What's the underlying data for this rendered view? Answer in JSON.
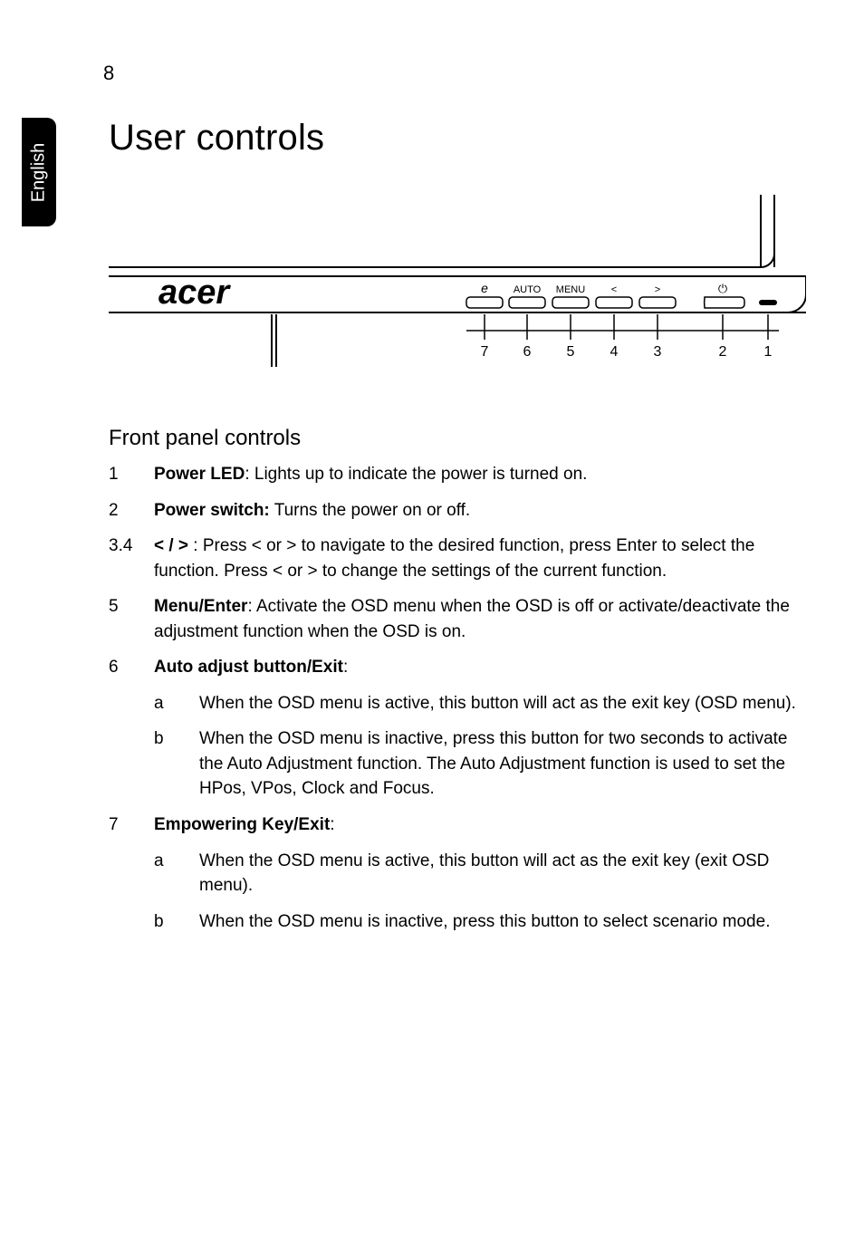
{
  "page_number": "8",
  "side_tab": "English",
  "heading": "User controls",
  "subheading": "Front panel controls",
  "diagram": {
    "brand": "acer",
    "buttons": {
      "empower_icon": "e",
      "auto": "AUTO",
      "menu": "MENU",
      "left": "<",
      "right": ">",
      "power_icon": "⏻"
    },
    "callouts": [
      "7",
      "6",
      "5",
      "4",
      "3",
      "2",
      "1"
    ]
  },
  "items": [
    {
      "n": "1",
      "label": "Power LED",
      "sep": ": ",
      "text": "Lights up to indicate the power is turned on."
    },
    {
      "n": "2",
      "label": "Power switch:",
      "sep": " ",
      "text": "Turns the power on or off."
    },
    {
      "n": "3.4",
      "label": "< / >",
      "sep": " : ",
      "text": "Press < or > to navigate to the desired function, press Enter to select the function. Press < or > to change the settings of the current function."
    },
    {
      "n": "5",
      "label": "Menu/Enter",
      "sep": ": ",
      "text": "Activate the OSD menu when the OSD is off or activate/deactivate the adjustment function when the OSD is on."
    },
    {
      "n": "6",
      "label": "Auto adjust button/Exit",
      "sep": ":",
      "text": "",
      "subs": [
        {
          "k": "a",
          "t": "When the OSD menu is active, this button will act as the exit key (OSD menu)."
        },
        {
          "k": "b",
          "t": "When the OSD menu is inactive, press this button for two seconds to activate the Auto Adjustment function. The Auto Adjustment function is used to set the HPos, VPos, Clock and Focus."
        }
      ]
    },
    {
      "n": "7",
      "label": "Empowering Key/Exit",
      "sep": ":",
      "text": "",
      "subs": [
        {
          "k": "a",
          "t": "When the OSD menu is active, this button will act as the exit key (exit OSD menu)."
        },
        {
          "k": "b",
          "t": "When the OSD menu is inactive, press this button to select scenario mode."
        }
      ]
    }
  ]
}
